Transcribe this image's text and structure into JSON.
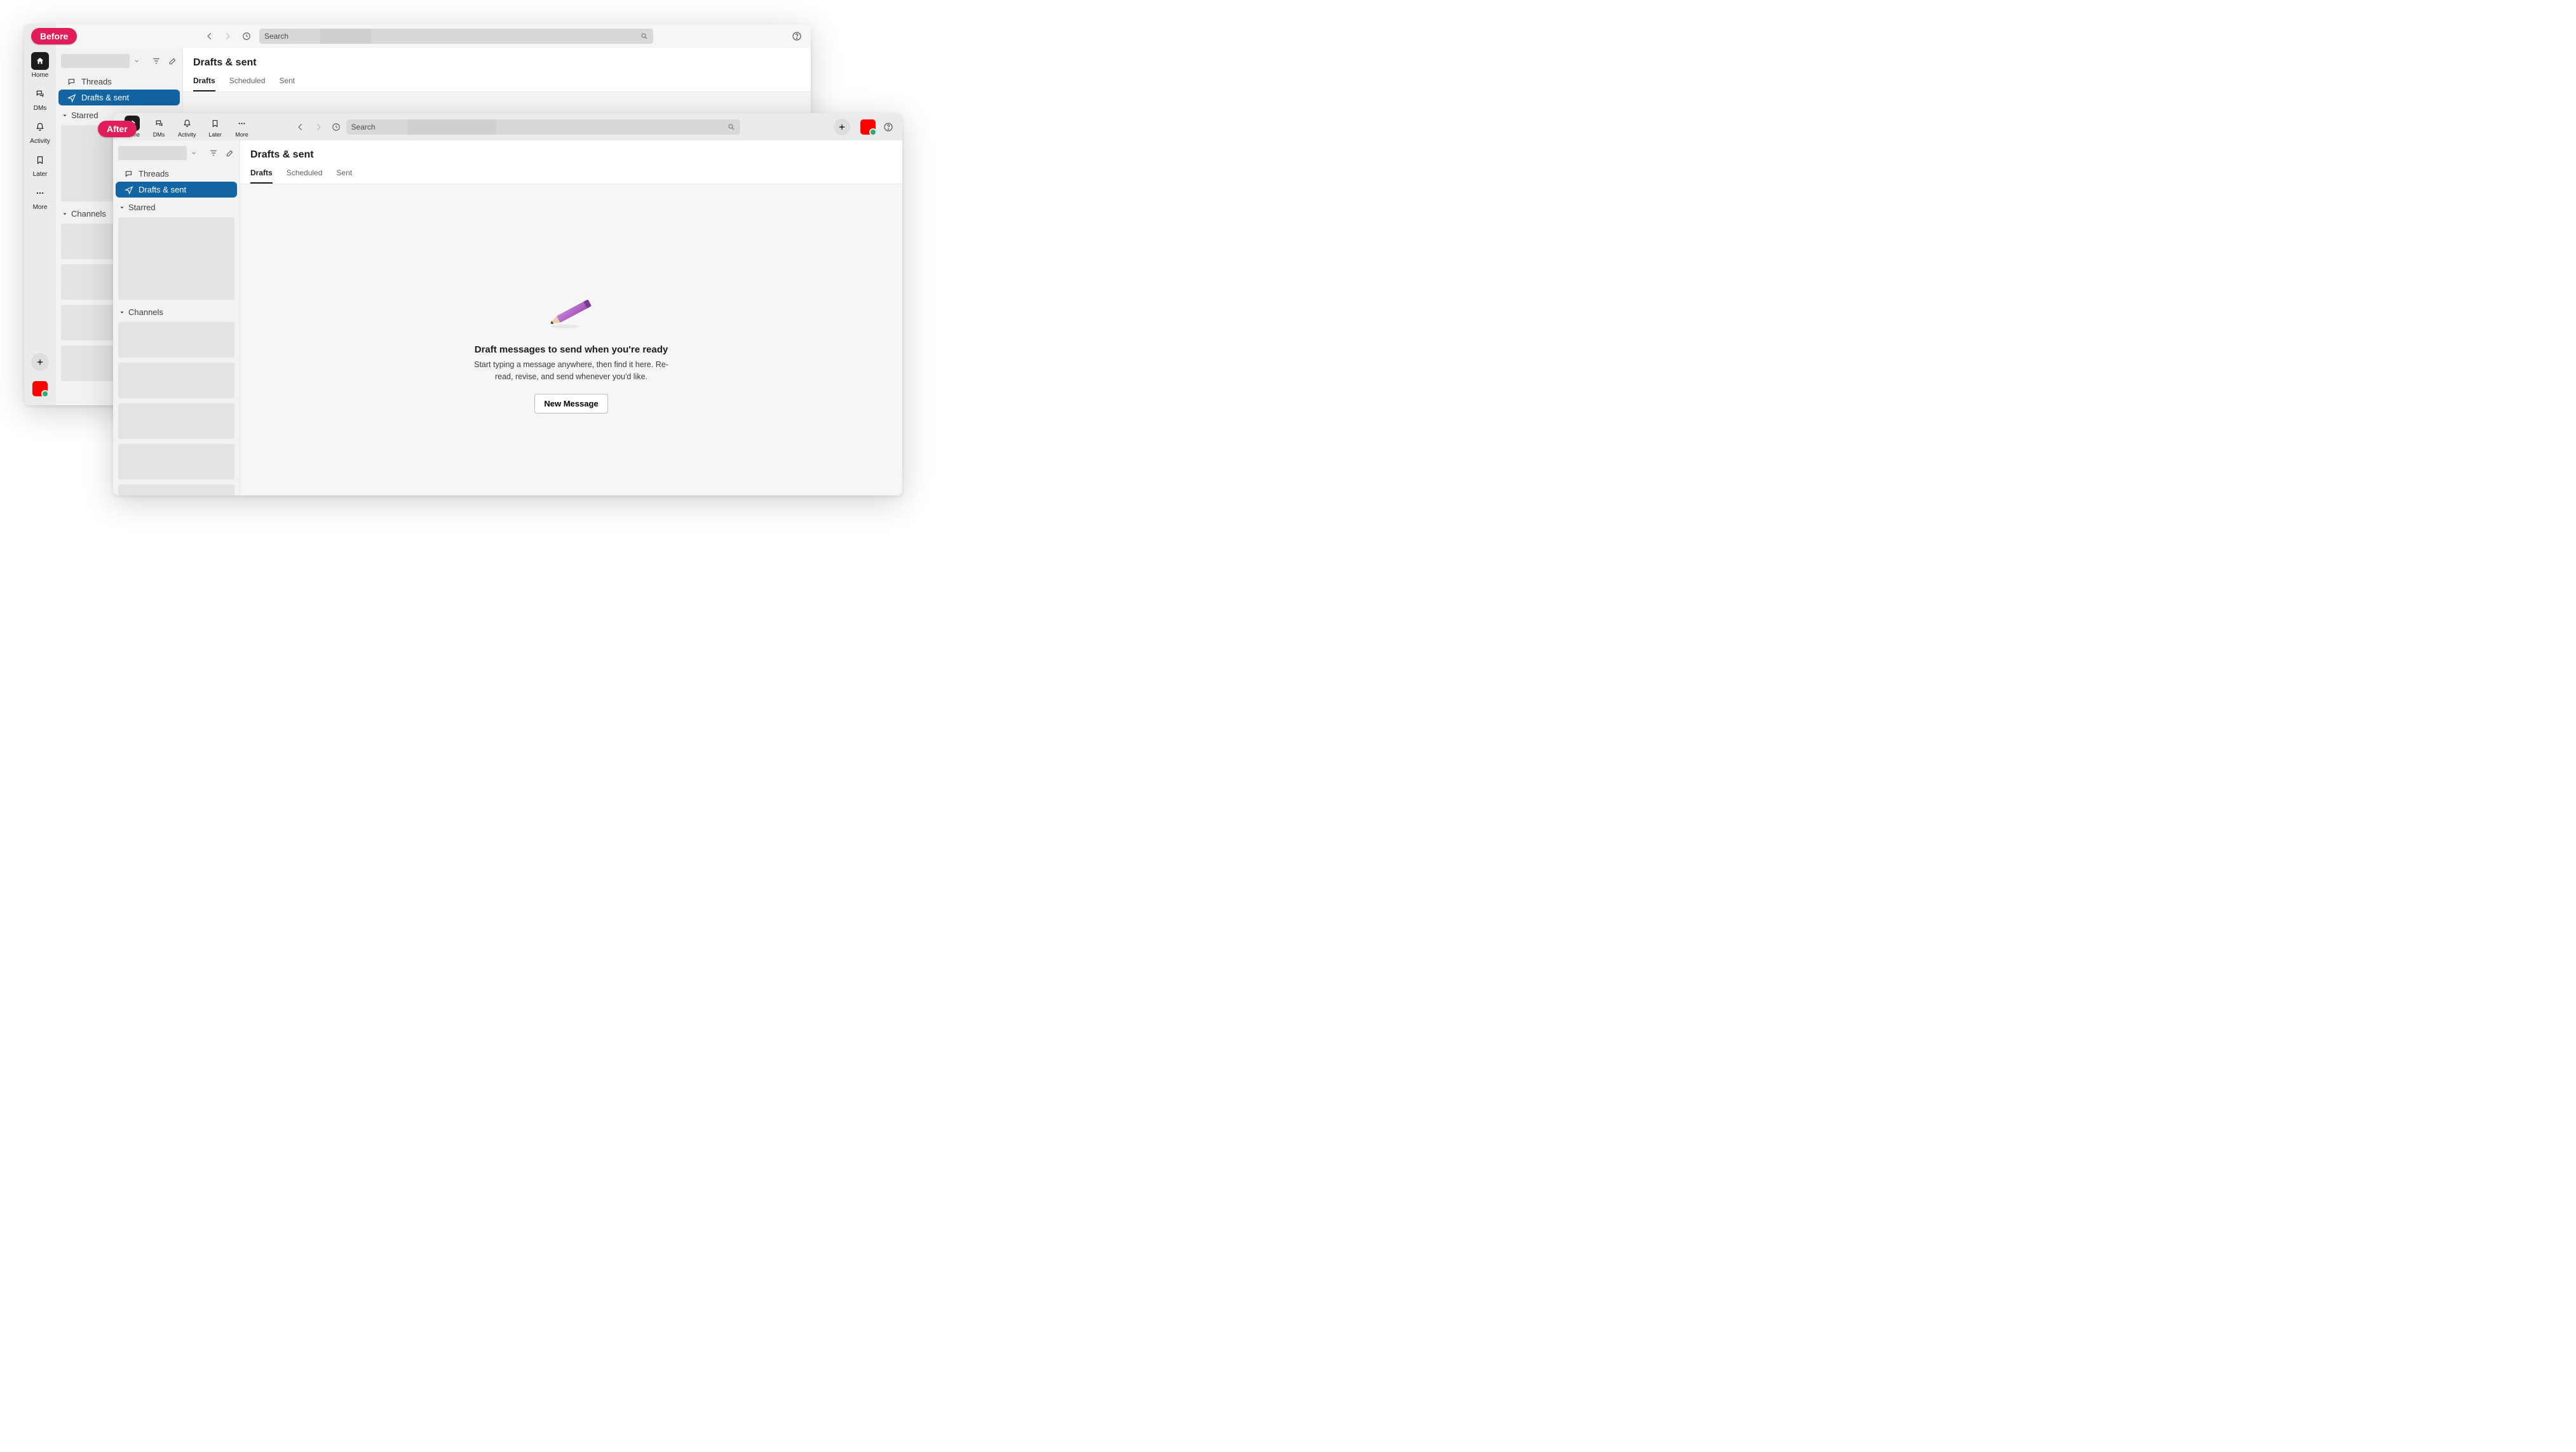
{
  "badges": {
    "before": "Before",
    "after": "After"
  },
  "rail": {
    "home": "Home",
    "dms": "DMs",
    "activity": "Activity",
    "later": "Later",
    "more": "More"
  },
  "topbar": {
    "search_placeholder": "Search"
  },
  "sidebar": {
    "threads": "Threads",
    "drafts_sent": "Drafts & sent",
    "starred": "Starred",
    "channels": "Channels"
  },
  "content": {
    "title": "Drafts & sent",
    "tabs": {
      "drafts": "Drafts",
      "scheduled": "Scheduled",
      "sent": "Sent"
    }
  },
  "empty": {
    "heading": "Draft messages to send when you're ready",
    "body": "Start typing a message anywhere, then find it here. Re-read, revise, and send whenever you'd like.",
    "button": "New Message"
  }
}
